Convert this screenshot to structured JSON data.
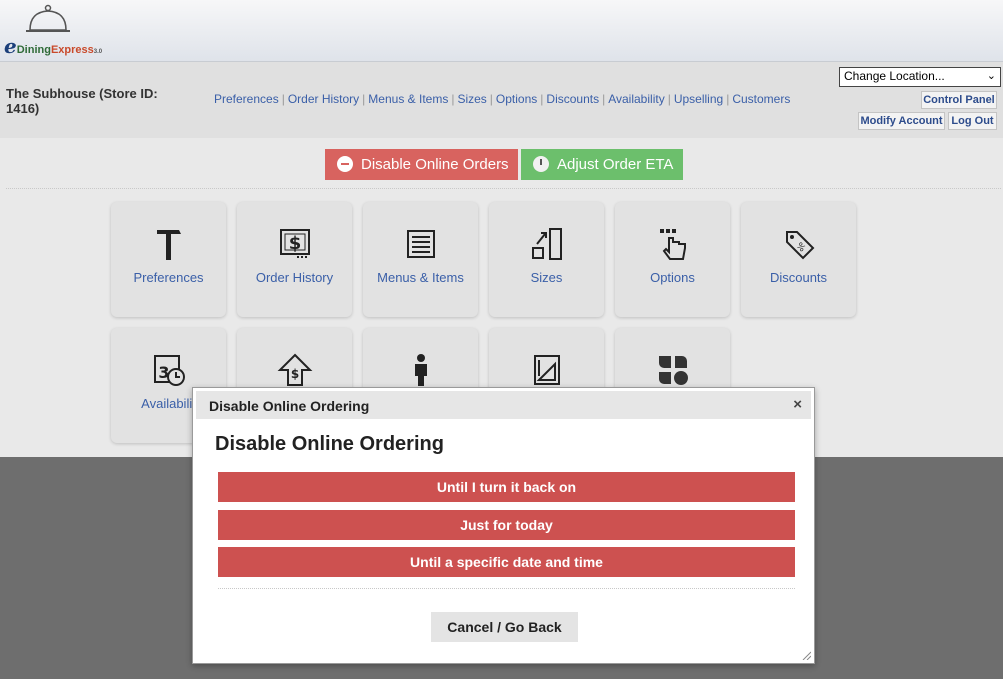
{
  "brand": {
    "e": "e",
    "dining": "Dining",
    "express": "Express",
    "version": "3.0"
  },
  "store": {
    "name": "The Subhouse (Store ID: 1416)"
  },
  "nav": {
    "links": [
      "Preferences",
      "Order History",
      "Menus & Items",
      "Sizes",
      "Options",
      "Discounts",
      "Availability",
      "Upselling",
      "Customers"
    ],
    "separator": "|"
  },
  "location_select": {
    "value": "Change Location..."
  },
  "account": {
    "control_panel": "Control Panel",
    "modify_account": "Modify Account",
    "log_out": "Log Out"
  },
  "actions": {
    "disable_label": "Disable Online Orders",
    "eta_label": "Adjust Order ETA"
  },
  "tiles": [
    {
      "label": "Preferences",
      "icon": "hammer-icon"
    },
    {
      "label": "Order History",
      "icon": "dollar-receipt-icon"
    },
    {
      "label": "Menus & Items",
      "icon": "menu-list-icon"
    },
    {
      "label": "Sizes",
      "icon": "resize-icon"
    },
    {
      "label": "Options",
      "icon": "pointer-hand-icon"
    },
    {
      "label": "Discounts",
      "icon": "price-tag-icon"
    },
    {
      "label": "Availabilit",
      "icon": "calendar-clock-icon"
    },
    {
      "label": "",
      "icon": "upsell-arrow-icon"
    },
    {
      "label": "",
      "icon": "person-icon"
    },
    {
      "label": "",
      "icon": "blueprint-icon"
    },
    {
      "label": "",
      "icon": "clover-icon"
    }
  ],
  "dialog": {
    "title": "Disable Online Ordering",
    "close": "×",
    "heading": "Disable Online Ordering",
    "options": [
      "Until I turn it back on",
      "Just for today",
      "Until a specific date and time"
    ],
    "cancel": "Cancel / Go Back"
  },
  "colors": {
    "disable_red": "#d8635f",
    "eta_green": "#6cbf6c",
    "option_red": "#cd5150",
    "link_blue": "#3a5fa8",
    "overlay_gray": "#6e6e6e"
  }
}
